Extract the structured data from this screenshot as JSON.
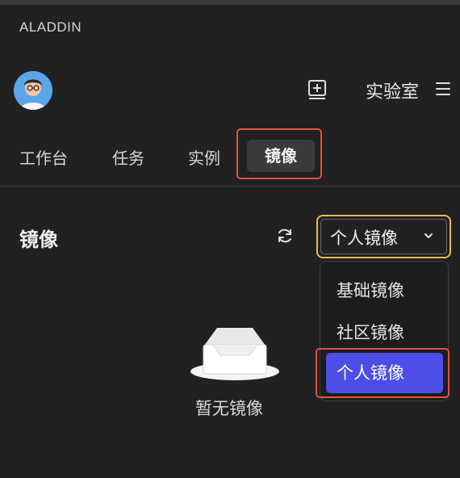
{
  "app": {
    "brand": "ALADDIN"
  },
  "header": {
    "lab_label": "实验室",
    "icons": [
      "add-box-icon",
      "menu-icon"
    ]
  },
  "tabs": [
    {
      "label": "工作台",
      "active": false
    },
    {
      "label": "任务",
      "active": false
    },
    {
      "label": "实例",
      "active": false
    },
    {
      "label": "镜像",
      "active": true
    }
  ],
  "section": {
    "title": "镜像",
    "refresh_icon": "refresh-icon",
    "select": {
      "value": "个人镜像",
      "icon": "chevron-down-icon"
    },
    "dropdown_options": [
      {
        "label": "基础镜像",
        "selected": false
      },
      {
        "label": "社区镜像",
        "selected": false
      },
      {
        "label": "个人镜像",
        "selected": true
      }
    ]
  },
  "empty_state": {
    "text": "暂无镜像",
    "icon": "empty-inbox-icon"
  },
  "colors": {
    "background": "#212121",
    "accent": "#4d4de8",
    "highlight": "#e0523f",
    "focus_border": "#f0b84e"
  }
}
